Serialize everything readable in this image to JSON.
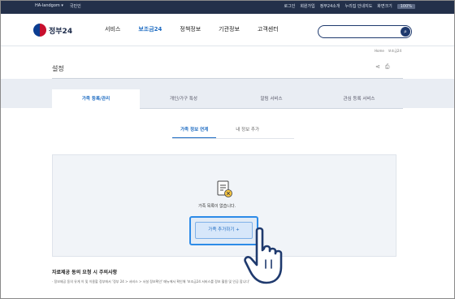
{
  "gov_bar": {
    "left_items": [
      "HA-landgom ▾",
      "국민인"
    ],
    "right_items": [
      "로그인",
      "회원가입",
      "정부24소개",
      "누리집 안내지도",
      "화면크기"
    ],
    "zoom": "100%"
  },
  "header": {
    "logo_text": "정부24",
    "nav": [
      "서비스",
      "보조금24",
      "정책정보",
      "기관정보",
      "고객센터"
    ],
    "active_nav_index": 1,
    "search_placeholder": ""
  },
  "breadcrumb": [
    "Home",
    "보조금24"
  ],
  "page": {
    "title": "설정",
    "tabs": [
      "가족 등록/관리",
      "개인/가구 특성",
      "알림 서비스",
      "관심 등록 서비스"
    ],
    "subtabs": [
      "가족 정보 연계",
      "내 정보 추가"
    ]
  },
  "empty_state": {
    "message": "가족 목록이 없습니다.",
    "add_button": "가족 추가하기 +"
  },
  "notice": {
    "title": "자료제공 동의 요청 시 주의사항",
    "body": "· 정보제공 동의 유게 이 및 이용할 정부에서 '정부 24 > 서비스 > 서설 정보확인' 메뉴에서 확인해 '보조금24 서비스를 정보 활용 및 인공 합니다'"
  },
  "colors": {
    "gov_bar": "#23304a",
    "accent": "#1d6bc2",
    "highlight": "#2d8be8"
  }
}
